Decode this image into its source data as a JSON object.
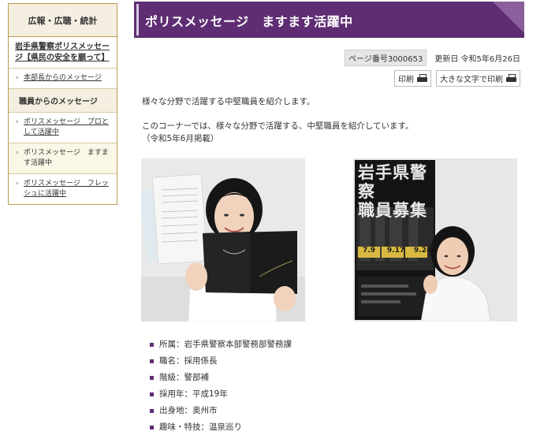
{
  "sidebar": {
    "header": "広報・広聴・統計",
    "parent_link": "岩手県警察ポリスメッセージ【県民の安全を願って】",
    "items_top": [
      {
        "label": "本部長からのメッセージ"
      }
    ],
    "section_heading": "職員からのメッセージ",
    "items": [
      {
        "label": "ポリスメッセージ　プロとして活躍中"
      },
      {
        "label": "ポリスメッセージ　ますます活躍中",
        "current": true
      },
      {
        "label": "ポリスメッセージ　フレッシュに活躍中"
      }
    ]
  },
  "page": {
    "title": "ポリスメッセージ　ますます活躍中",
    "page_number": "ページ番号3000653",
    "updated": "更新日  令和5年6月26日",
    "print_label": "印刷",
    "print_large_label": "大きな文字で印刷",
    "intro": "様々な分野で活躍する中堅職員を紹介します。",
    "para_line1": "このコーナーでは、様々な分野で活躍する、中堅職員を紹介しています。",
    "para_line2": "（令和5年6月掲載）"
  },
  "photo2_text": {
    "poster_title1": "岩手県警察",
    "poster_title2": "職員募集",
    "date1": "7.9",
    "date2": "9.17",
    "date3": "9.24"
  },
  "profile": [
    {
      "text": "所属：岩手県警察本部警務部警務課"
    },
    {
      "text": "職名：採用係長"
    },
    {
      "text": "階級：警部補"
    },
    {
      "text": "採用年：平成19年"
    },
    {
      "text": "出身地：奥州市"
    },
    {
      "text": "趣味・特技：温泉巡り"
    }
  ],
  "colors": {
    "accent": "#5f2d73",
    "sidebar_border": "#b99d54"
  }
}
